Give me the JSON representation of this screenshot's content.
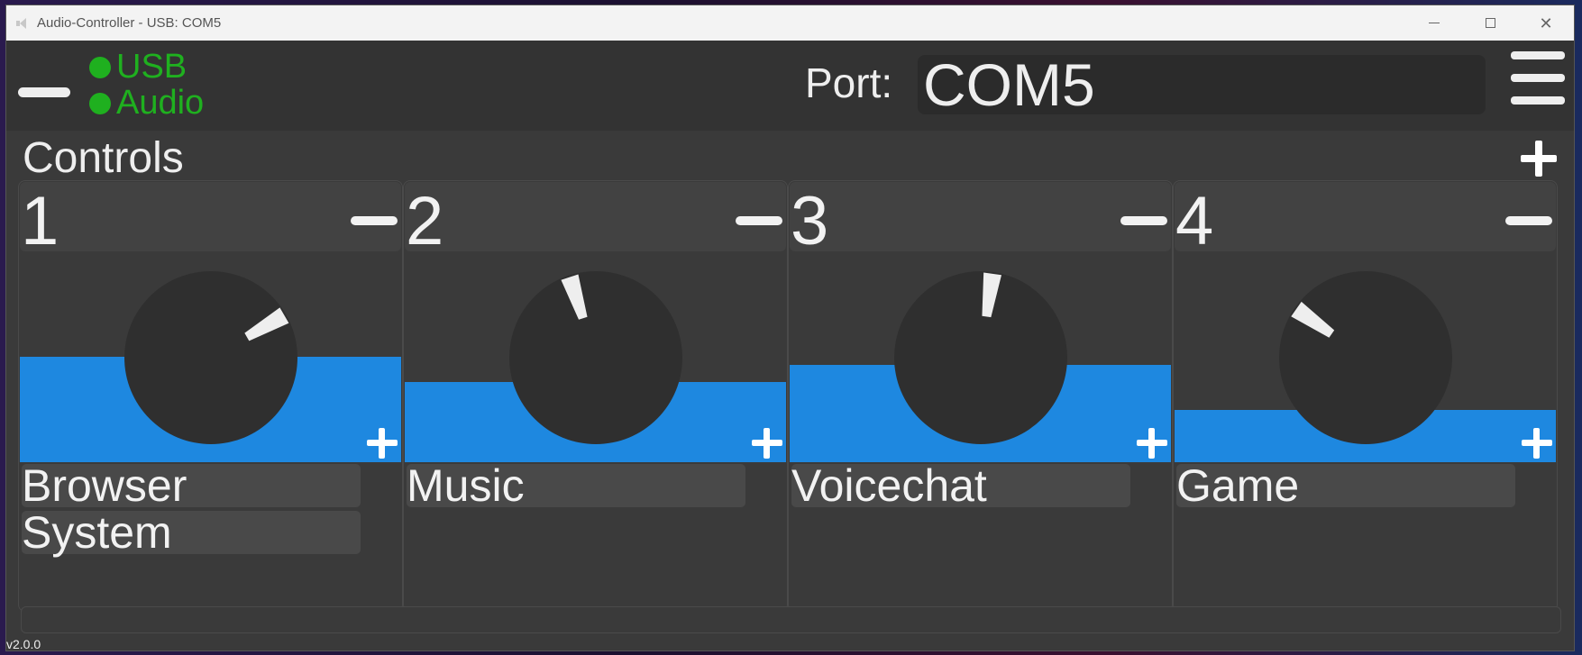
{
  "window": {
    "title": "Audio-Controller - USB: COM5"
  },
  "status": {
    "usb_label": "USB",
    "audio_label": "Audio",
    "color": "#1fb01f"
  },
  "port": {
    "label": "Port:",
    "value": "COM5"
  },
  "controls": {
    "title": "Controls",
    "panels": [
      {
        "number": "1",
        "volume_percent": 50,
        "knob_angle_deg": 60,
        "apps": [
          "Browser",
          "System"
        ]
      },
      {
        "number": "2",
        "volume_percent": 38,
        "knob_angle_deg": -18,
        "apps": [
          "Music"
        ]
      },
      {
        "number": "3",
        "volume_percent": 46,
        "knob_angle_deg": 8,
        "apps": [
          "Voicechat"
        ]
      },
      {
        "number": "4",
        "volume_percent": 25,
        "knob_angle_deg": -55,
        "apps": [
          "Game"
        ]
      }
    ]
  },
  "version": "v2.0.0",
  "colors": {
    "accent": "#1e88e0",
    "background": "#3a3a3a",
    "knob": "#2f2f2f",
    "text": "#eeeeee"
  }
}
